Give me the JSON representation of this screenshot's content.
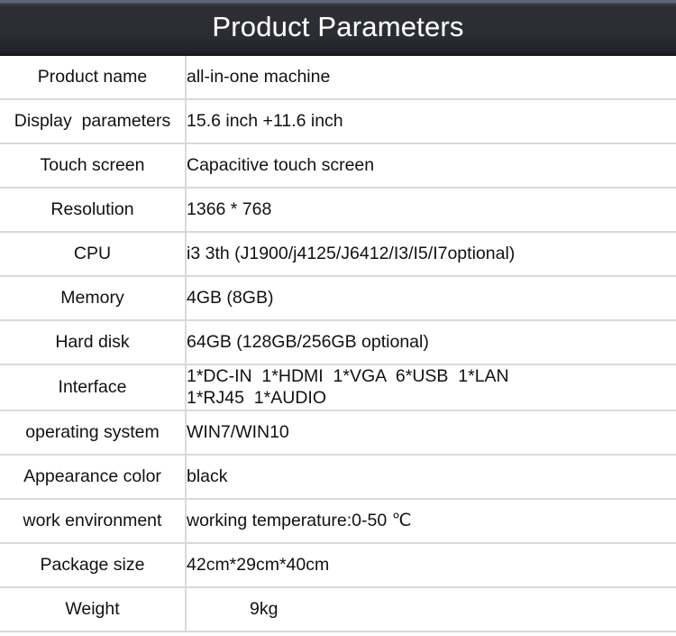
{
  "header": {
    "title": "Product Parameters",
    "bg_color": "#2b2d33",
    "accent_top_color": "#5d6778",
    "text_color": "#ffffff"
  },
  "table": {
    "grid_color": "#d9d9d9",
    "rows": [
      {
        "label": "Product name",
        "value": "all-in-one machine"
      },
      {
        "label": "Display  parameters",
        "value": "15.6 inch +11.6 inch"
      },
      {
        "label": "Touch screen",
        "value": "Capacitive touch screen"
      },
      {
        "label": "Resolution",
        "value": "1366 * 768"
      },
      {
        "label": "CPU",
        "value": "i3 3th (J1900/j4125/J6412/I3/I5/I7optional)"
      },
      {
        "label": "Memory",
        "value": "4GB (8GB)"
      },
      {
        "label": "Hard disk",
        "value": "64GB (128GB/256GB optional)"
      },
      {
        "label": "Interface",
        "value_line1": "1*DC-IN  1*HDMI  1*VGA  6*USB  1*LAN",
        "value_line2": "1*RJ45  1*AUDIO"
      },
      {
        "label": "operating system",
        "value": "WIN7/WIN10"
      },
      {
        "label": "Appearance color",
        "value": "black"
      },
      {
        "label": "work environment",
        "value": "working temperature:0-50 ℃"
      },
      {
        "label": "Package size",
        "value": "42cm*29cm*40cm"
      },
      {
        "label": "Weight",
        "value": "9kg"
      }
    ]
  }
}
